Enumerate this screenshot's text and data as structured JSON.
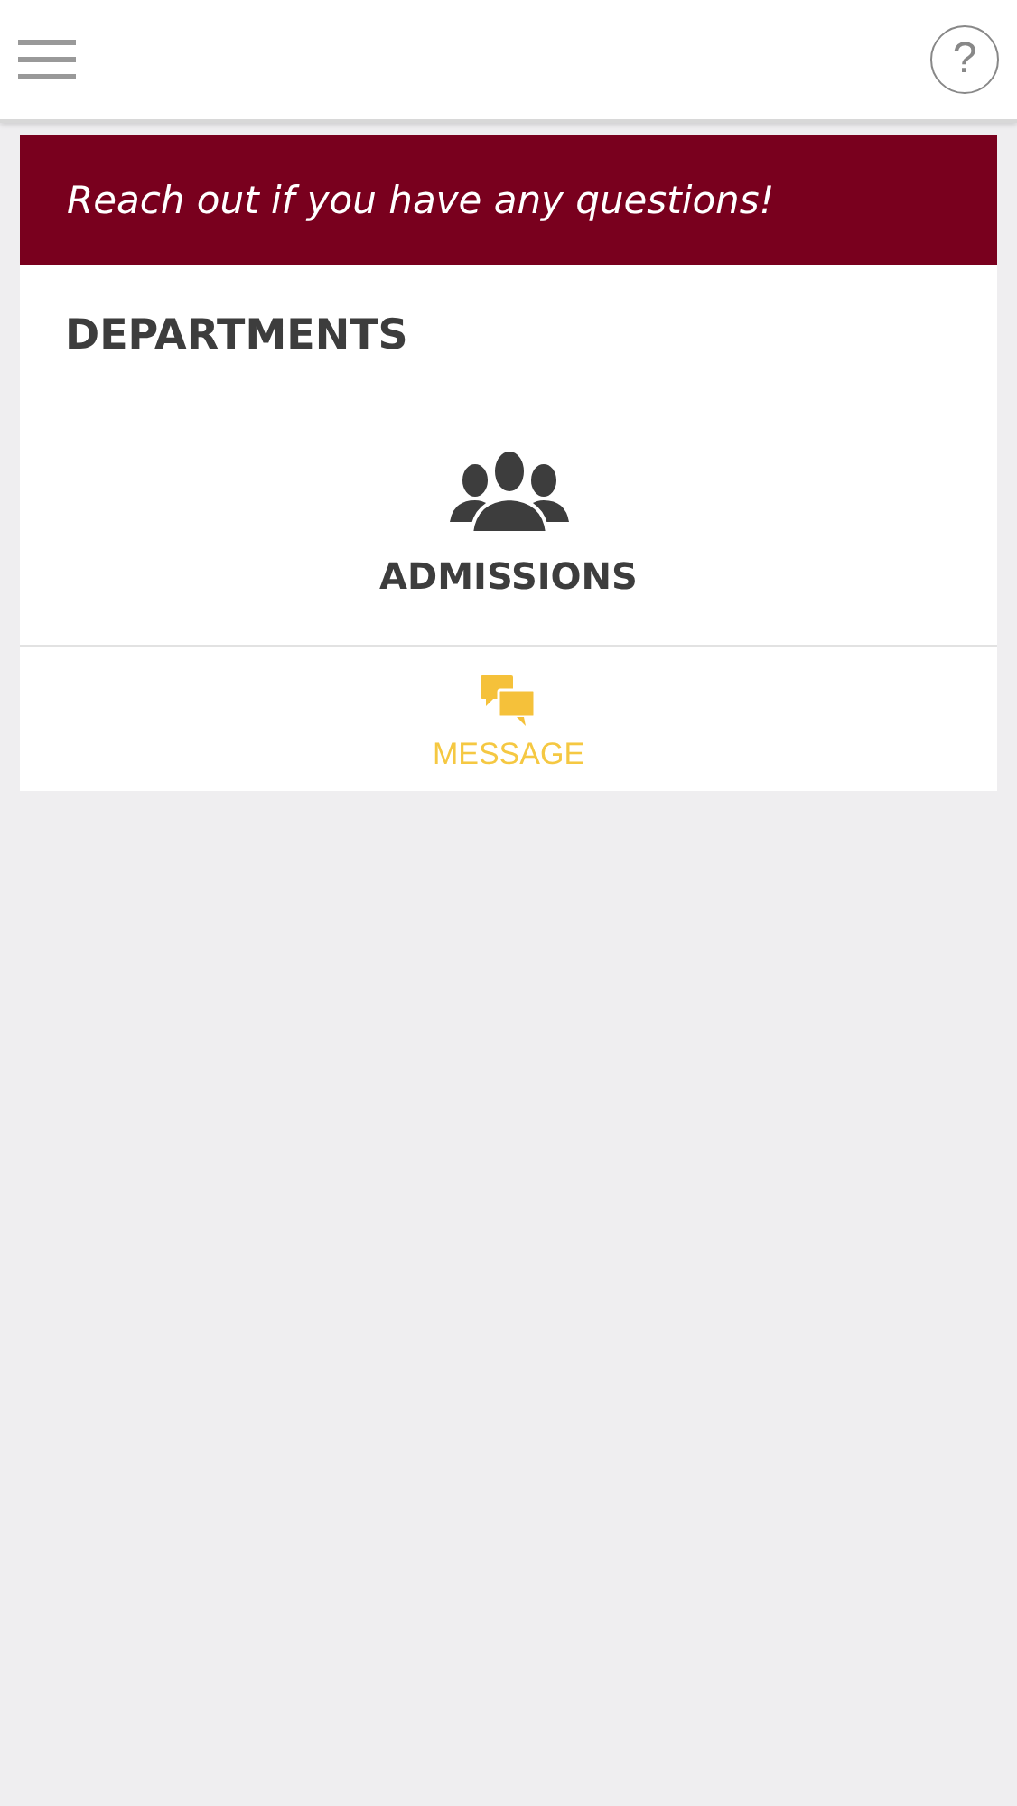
{
  "top_bar": {
    "help_label": "?"
  },
  "banner": {
    "text": "Reach out if you have any questions!"
  },
  "section_title": "DEPARTMENTS",
  "departments": [
    {
      "name": "ADMISSIONS",
      "action": "MESSAGE"
    }
  ]
}
